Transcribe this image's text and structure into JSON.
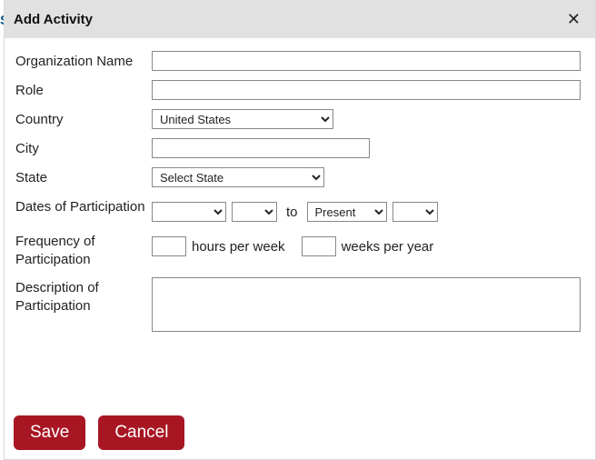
{
  "leftAccentChar": "S",
  "dialog": {
    "title": "Add Activity",
    "closeGlyph": "✕"
  },
  "labels": {
    "orgName": "Organization Name",
    "role": "Role",
    "country": "Country",
    "city": "City",
    "state": "State",
    "dates": "Dates of Participation",
    "freq": "Frequency of Participation",
    "desc": "Description of Participation"
  },
  "values": {
    "orgName": "",
    "role": "",
    "countrySelected": "United States",
    "city": "",
    "statePlaceholder": "Select State",
    "dateFromMonth": "",
    "dateFromYear": "",
    "toWord": "to",
    "dateToMonth": "Present",
    "dateToYear": "",
    "hoursPerWeek": "",
    "weeksPerYear": "",
    "description": ""
  },
  "freqText": {
    "hours": "hours per week",
    "weeks": "weeks per year"
  },
  "buttons": {
    "save": "Save",
    "cancel": "Cancel"
  }
}
